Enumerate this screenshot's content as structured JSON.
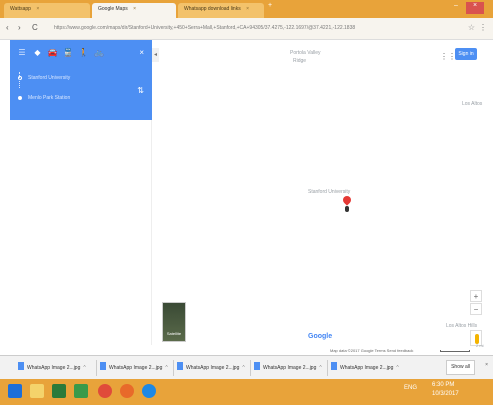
{
  "browser": {
    "tabs": [
      {
        "label": "Wattsapp",
        "close": "×"
      },
      {
        "label": "Google Maps",
        "close": "×"
      },
      {
        "label": "Whatsapp download links",
        "close": "×"
      }
    ],
    "new_tab": "+",
    "url": "https://www.google.com/maps/dir/Stanford+University,+450+Serra+Mall,+Stanford,+CA+94305/37.4275,-122.1697/@37.4221,-122.1838",
    "nav": {
      "back": "‹",
      "forward": "›",
      "reload": "C"
    }
  },
  "directions": {
    "modes": [
      "☰",
      "◆",
      "🚘",
      "🚆",
      "🚶",
      "🚲"
    ],
    "close": "×",
    "from": "Stanford University",
    "to": "Menlo Park Station",
    "swap": "⇅"
  },
  "map": {
    "labels": {
      "top_center": "Portola Valley",
      "top_center_sub": "Ridge",
      "right": "Los Altos",
      "pin": "Stanford University",
      "bottom_right": "Los Altos Hills"
    },
    "signin": "Sign in",
    "apps": "⋮⋮",
    "collapse": "◂",
    "satellite": "Satellite",
    "google": "Google",
    "zoom_in": "+",
    "zoom_out": "−",
    "footer": "Map data ©2017 Google   Terms   Send feedback",
    "scale": "2 mi"
  },
  "downloads": {
    "items": [
      {
        "name": "WhatsApp Image 2...jpg"
      },
      {
        "name": "WhatsApp Image 2...jpg"
      },
      {
        "name": "WhatsApp Image 2...jpg"
      },
      {
        "name": "WhatsApp Image 2...jpg"
      },
      {
        "name": "WhatsApp Image 2...jpg"
      }
    ],
    "show_all": "Show all",
    "close": "×"
  },
  "taskbar": {
    "time": "6:30 PM",
    "date": "10/3/2017",
    "tray": "ENG"
  }
}
